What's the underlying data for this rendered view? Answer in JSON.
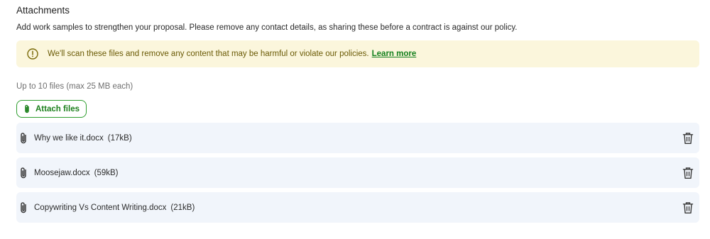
{
  "attachments": {
    "title": "Attachments",
    "description": "Add work samples to strengthen your proposal. Please remove any contact details, as sharing these before a contract is against our policy.",
    "notice": {
      "icon": "alert-circle-icon",
      "text": "We'll scan these files and remove any content that may be harmful or violate our policies.",
      "link_label": "Learn more"
    },
    "limit_text": "Up to 10 files (max 25 MB each)",
    "attach_button_label": "Attach files",
    "files": [
      {
        "name": "Why we like it.docx",
        "size": "(17kB)"
      },
      {
        "name": "Moosejaw.docx",
        "size": "(59kB)"
      },
      {
        "name": "Copywriting Vs Content Writing.docx",
        "size": "(21kB)"
      }
    ]
  },
  "colors": {
    "accent_green": "#1b7f1b",
    "notice_background": "#fbf6dc",
    "file_row_background": "#f1f5fb"
  }
}
